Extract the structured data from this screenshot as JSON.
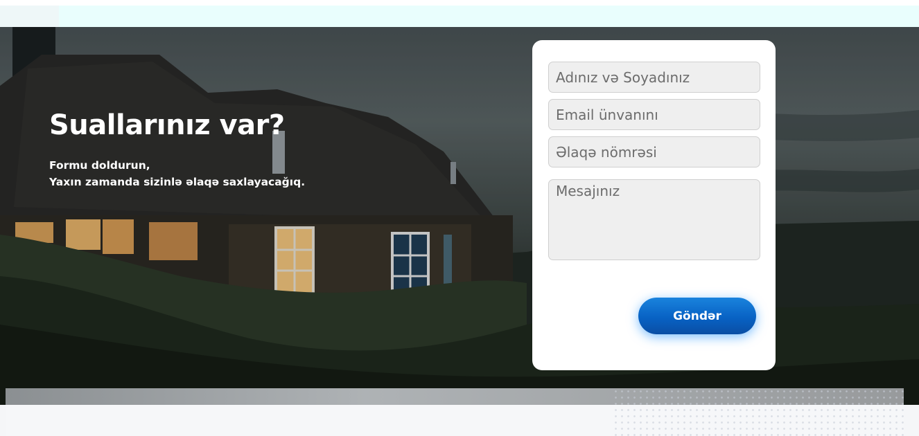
{
  "hero": {
    "title": "Suallarınız var?",
    "subtitle_line1": "Formu doldurun,",
    "subtitle_line2": "Yaxın zamanda sizinlə əlaqə saxlayacağıq."
  },
  "form": {
    "name_placeholder": "Adınız və Soyadınız",
    "email_placeholder": "Email ünvanını",
    "phone_placeholder": "Əlaqə nömrəsi",
    "message_placeholder": "Mesajınız",
    "submit_label": "Göndər"
  },
  "colors": {
    "accent": "#0a6ed1",
    "card": "#ffffff",
    "field_bg": "#efefef",
    "topbar_strip": "#e9fefd"
  }
}
